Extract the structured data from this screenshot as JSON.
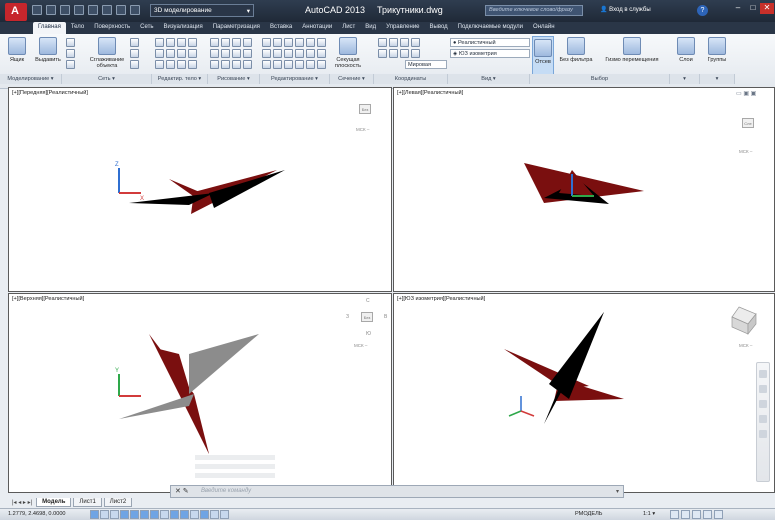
{
  "title_bar": {
    "workspace": "3D моделирование",
    "app_name": "AutoCAD 2013",
    "file_name": "Трикутники.dwg",
    "search_placeholder": "Введите ключевое слово/фразу",
    "sign_in": "Вход в службы",
    "help": "?"
  },
  "ribbon_tabs": [
    "Главная",
    "Тело",
    "Поверхность",
    "Сеть",
    "Визуализация",
    "Параметризация",
    "Вставка",
    "Аннотации",
    "Лист",
    "Вид",
    "Управление",
    "Вывод",
    "Подключаемые модули",
    "Онлайн"
  ],
  "ribbon": {
    "box": "Ящик",
    "extrude": "Выдавить",
    "smooth_line1": "Сглаживание",
    "smooth_line2": "объекта",
    "section_plane_line1": "Секущая",
    "section_plane_line2": "плоскость",
    "visual_style": "Реалистичный",
    "view": "ЮЗ изометрия",
    "ucs": "Мировая",
    "culling": "Отсев",
    "no_filter": "Без фильтра",
    "gizmo": "Гизмо перемещения",
    "layers": "Слои",
    "groups": "Группы"
  },
  "panel_labels": [
    "Моделирование ▾",
    "Сеть ▾",
    "Редактир. тело ▾",
    "Рисование ▾",
    "Редактирование ▾",
    "Сечение ▾",
    "Координаты",
    "Вид ▾",
    "Выбор",
    "▾",
    "▾"
  ],
  "viewports": {
    "front": "[+][Передняя][Реалистичный]",
    "left": "[+][Левая][Реалистичный]",
    "top": "[+][Верхняя][Реалистичный]",
    "sw_iso": "[+][ЮЗ изометрия][Реалистичный]"
  },
  "viewcube": {
    "front": "Без",
    "left": "Сле",
    "top": "Без",
    "wcs": "МСК –",
    "compass_n": "С",
    "compass_s": "Ю",
    "compass_w": "З",
    "compass_e": "В"
  },
  "layout_tabs": [
    "Модель",
    "Лист1",
    "Лист2"
  ],
  "command_line": {
    "placeholder": "Введите команду"
  },
  "status": {
    "coords": "1.2779, 2.4698, 0.0000",
    "model": "РМОДЕЛЬ",
    "scale": "1:1 ▾"
  },
  "colors": {
    "dark_red": "#7a0f0f",
    "black": "#000000",
    "gray": "#8c8c8c",
    "axis_x": "#d23b3b",
    "axis_y": "#2ea84a",
    "axis_z": "#2f6fd1"
  }
}
